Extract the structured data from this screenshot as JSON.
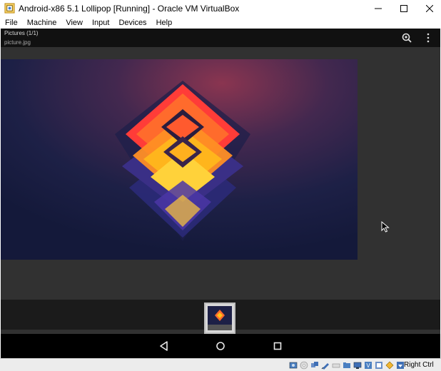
{
  "window": {
    "title": "Android-x86 5.1 Lollipop [Running] - Oracle VM VirtualBox"
  },
  "menu": {
    "items": [
      "File",
      "Machine",
      "View",
      "Input",
      "Devices",
      "Help"
    ]
  },
  "gallery": {
    "title": "Pictures (1/1)",
    "subtitle": "picture.jpg"
  },
  "status_bar": {
    "icons": [
      "hard-disk-icon",
      "optical-drive-icon",
      "audio-icon",
      "network-icon",
      "usb-icon",
      "shared-folders-icon",
      "display-icon",
      "video-capture-icon",
      "mouse-integration-icon",
      "keyboard-capture-icon",
      "arrow-down-icon"
    ],
    "host_key": "Right Ctrl"
  },
  "colors": {
    "android_bg": "#313131",
    "action_bar": "#111111",
    "nav_bar": "#000000",
    "photo_bg": "#1a1c3c"
  }
}
